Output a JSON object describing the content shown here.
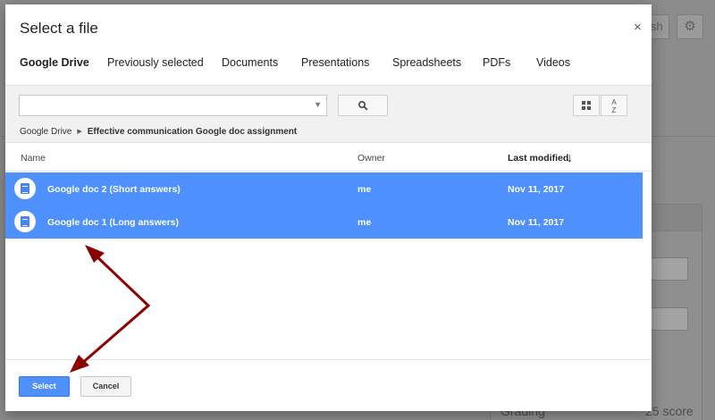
{
  "background": {
    "publish_label": "sh",
    "grading_label": "Grading",
    "score_label": "25 score"
  },
  "dialog": {
    "title": "Select a file",
    "close_glyph": "×"
  },
  "tabs": [
    {
      "label": "Google Drive",
      "active": true
    },
    {
      "label": "Previously selected",
      "active": false
    },
    {
      "label": "Documents",
      "active": false
    },
    {
      "label": "Presentations",
      "active": false
    },
    {
      "label": "Spreadsheets",
      "active": false
    },
    {
      "label": "PDFs",
      "active": false
    },
    {
      "label": "Videos",
      "active": false
    }
  ],
  "search": {
    "value": "",
    "placeholder": ""
  },
  "breadcrumb": {
    "root": "Google Drive",
    "current": "Effective communication Google doc assignment"
  },
  "table": {
    "columns": {
      "name": "Name",
      "owner": "Owner",
      "modified": "Last modified",
      "sort_glyph": "↓"
    },
    "rows": [
      {
        "name": "Google doc 2 (Short answers)",
        "owner": "me",
        "modified": "Nov 11, 2017",
        "selected": true
      },
      {
        "name": "Google doc 1 (Long answers)",
        "owner": "me",
        "modified": "Nov 11, 2017",
        "selected": true
      }
    ]
  },
  "footer": {
    "select_label": "Select",
    "cancel_label": "Cancel"
  },
  "colors": {
    "accent": "#4d90fe",
    "annotation": "#8b0000"
  },
  "icons": [
    "gear-icon",
    "close-icon",
    "search-icon",
    "grid-view-icon",
    "sort-az-icon",
    "dropdown-caret-icon",
    "google-doc-icon",
    "sort-down-arrow-icon"
  ]
}
